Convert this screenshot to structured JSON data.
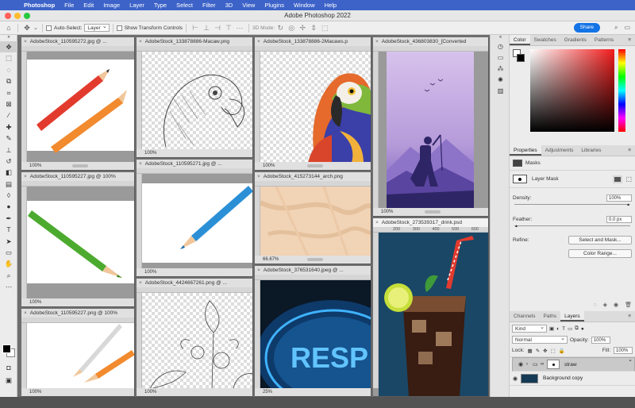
{
  "menubar": {
    "app": "Photoshop",
    "items": [
      "File",
      "Edit",
      "Image",
      "Layer",
      "Type",
      "Select",
      "Filter",
      "3D",
      "View",
      "Plugins",
      "Window",
      "Help"
    ]
  },
  "window_title": "Adobe Photoshop 2022",
  "options": {
    "auto_select_label": "Auto-Select:",
    "auto_select_value": "Layer",
    "show_transform_label": "Show Transform Controls",
    "mode_3d_label": "3D Mode:",
    "share_label": "Share"
  },
  "documents": [
    {
      "title": "AdobeStock_110595272.jpg @ ...",
      "zoom": "100%"
    },
    {
      "title": "AdobeStock_133878886-Macaw.png",
      "zoom": "100%"
    },
    {
      "title": "AdobeStock_133878886-2Macaws.p",
      "zoom": "100%"
    },
    {
      "title": "AdobeStock_436803830_[Converted",
      "zoom": "100%"
    },
    {
      "title": "AdobeStock_110595227.jpg @ 100%",
      "zoom": "100%"
    },
    {
      "title": "AdobeStock_110595271.jpg @ ...",
      "zoom": "100%"
    },
    {
      "title": "AdobeStock_415273144_arch.png",
      "zoom": "66.67%"
    },
    {
      "title": "AdobeStock_273539317_drink.psd",
      "zoom": "100%",
      "ruler": [
        "200",
        "300",
        "400",
        "500",
        "600",
        "700"
      ]
    },
    {
      "title": "AdobeStock_4424667261.png @ ...",
      "zoom": "100%"
    },
    {
      "title": "AdobeStock_376531640.jpeg @ ...",
      "zoom": "25%",
      "art_text": "RESP"
    },
    {
      "title": "AdobeStock_110595227.png @ 100%",
      "zoom": "100%"
    }
  ],
  "color_panel": {
    "tabs": [
      "Color",
      "Swatches",
      "Gradients",
      "Patterns"
    ]
  },
  "properties_panel": {
    "tabs": [
      "Properties",
      "Adjustments",
      "Libraries"
    ],
    "section": "Masks",
    "mask_label": "Layer Mask",
    "density_label": "Density:",
    "density_value": "100%",
    "feather_label": "Feather:",
    "feather_value": "0.0 px",
    "refine_label": "Refine:",
    "select_mask_button": "Select and Mask...",
    "color_range_button": "Color Range..."
  },
  "layers_panel": {
    "tabs": [
      "Channels",
      "Paths",
      "Layers"
    ],
    "filter_kind": "Kind",
    "blend_mode": "Normal",
    "opacity_label": "Opacity:",
    "opacity_value": "100%",
    "lock_label": "Lock:",
    "fill_label": "Fill:",
    "fill_value": "100%",
    "layers": [
      {
        "name": "straw"
      },
      {
        "name": "Background copy"
      }
    ]
  },
  "colors": {
    "accent": "#1473e6",
    "menubar": "#3d63c9"
  }
}
